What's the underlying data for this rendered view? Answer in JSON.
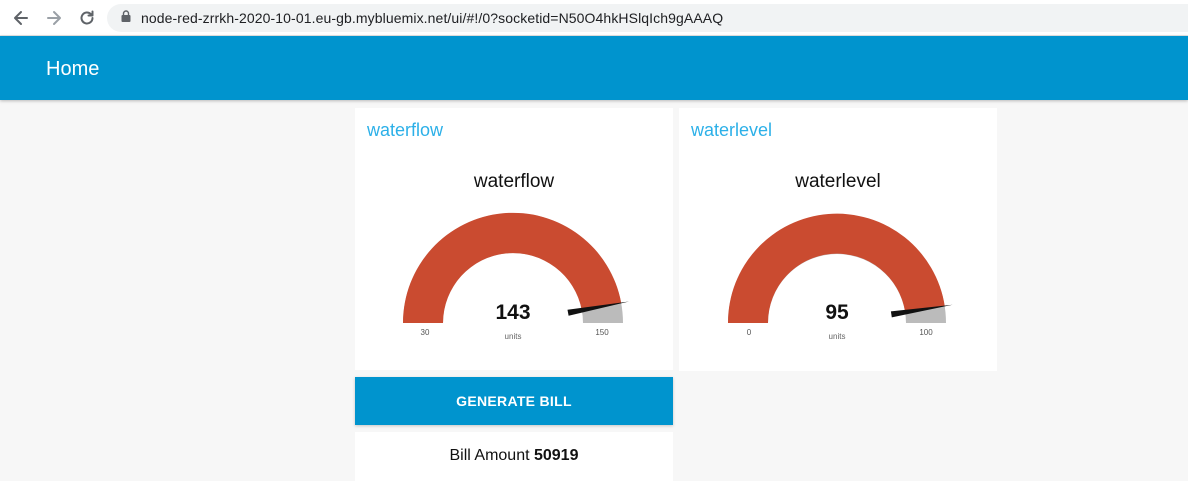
{
  "browser": {
    "url": "node-red-zrrkh-2020-10-01.eu-gb.mybluemix.net/ui/#!/0?socketid=N50O4hkHSlqIch9gAAAQ"
  },
  "toolbar": {
    "title": "Home"
  },
  "colors": {
    "accent": "#0094ce",
    "gauge_fill": "#ca4b30",
    "gauge_track": "#bbbbbb",
    "card_title": "#2cb0e8"
  },
  "gauges": [
    {
      "group_title": "waterflow",
      "label": "waterflow",
      "value": "143",
      "units": "units",
      "min": "30",
      "max": "150",
      "value_num": 143,
      "min_num": 30,
      "max_num": 150
    },
    {
      "group_title": "waterlevel",
      "label": "waterlevel",
      "value": "95",
      "units": "units",
      "min": "0",
      "max": "100",
      "value_num": 95,
      "min_num": 0,
      "max_num": 100
    }
  ],
  "bill": {
    "button_label": "GENERATE BILL",
    "amount_label": "Bill Amount",
    "amount_value": "50919"
  }
}
